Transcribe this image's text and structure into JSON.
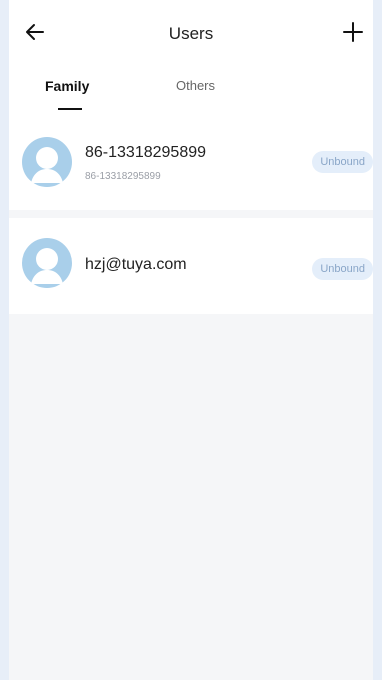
{
  "header": {
    "title": "Users",
    "back_icon": "arrow-left-icon",
    "add_icon": "plus-icon"
  },
  "tabs": [
    {
      "label": "Family",
      "active": true
    },
    {
      "label": "Others",
      "active": false
    }
  ],
  "users": [
    {
      "name": "86-13318295899",
      "subtitle": "86-13318295899",
      "status": "Unbound",
      "avatar": "user-avatar-icon"
    },
    {
      "name": "hzj@tuya.com",
      "subtitle": "",
      "status": "Unbound",
      "avatar": "user-avatar-icon"
    }
  ],
  "colors": {
    "background": "#e7eef8",
    "badge_bg": "#e4eefa",
    "badge_text": "#8aa6c8",
    "avatar": "#a9cfea"
  }
}
